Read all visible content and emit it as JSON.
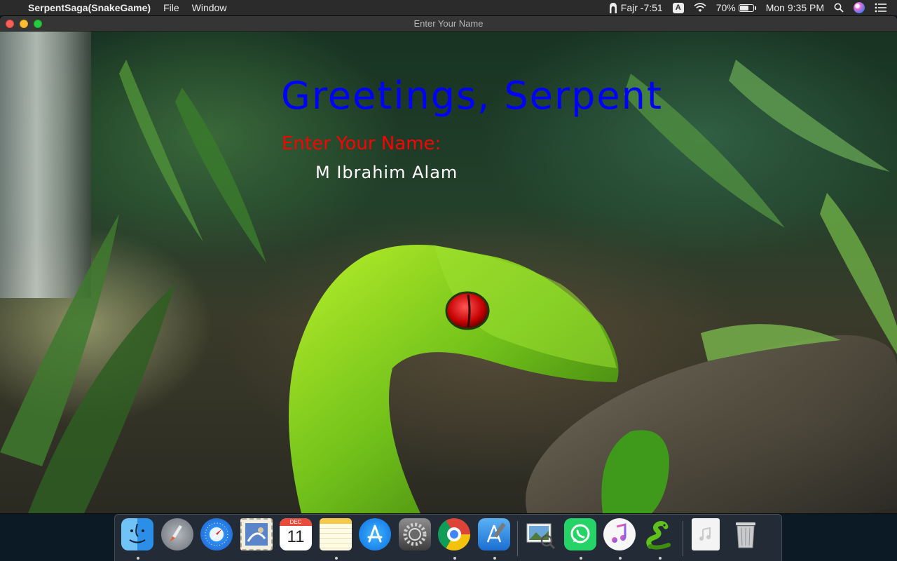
{
  "menubar": {
    "apple_symbol": "",
    "app_name": "SerpentSaga(SnakeGame)",
    "menus": [
      "File",
      "Window"
    ],
    "prayer_time": "Fajr -7:51",
    "input_source": "A",
    "battery_percent": "70%",
    "battery_level": 0.7,
    "clock": "Mon 9:35 PM"
  },
  "window": {
    "title": "Enter Your Name"
  },
  "game": {
    "greeting": "Greetings, Serpent",
    "prompt": "Enter Your Name:",
    "name_value": "M Ibrahim Alam",
    "colors": {
      "greeting": "#0000ff",
      "prompt": "#ff0000",
      "name": "#ffffff"
    }
  },
  "calendar": {
    "month": "DEC",
    "day": "11"
  },
  "dock": {
    "apps": [
      {
        "name": "finder-icon",
        "running": true
      },
      {
        "name": "launchpad-icon",
        "running": false
      },
      {
        "name": "safari-icon",
        "running": false
      },
      {
        "name": "mail-icon",
        "running": false
      },
      {
        "name": "calendar-icon",
        "running": false
      },
      {
        "name": "notes-icon",
        "running": true
      },
      {
        "name": "app-store-icon",
        "running": false
      },
      {
        "name": "system-preferences-icon",
        "running": false
      },
      {
        "name": "chrome-icon",
        "running": true
      },
      {
        "name": "xcode-icon",
        "running": true
      },
      {
        "name": "preview-icon",
        "running": false
      },
      {
        "name": "whatsapp-icon",
        "running": true
      },
      {
        "name": "itunes-icon",
        "running": true
      },
      {
        "name": "snake-game-icon",
        "running": true
      },
      {
        "name": "music-file-icon",
        "running": false
      },
      {
        "name": "trash-icon",
        "running": false
      }
    ]
  }
}
